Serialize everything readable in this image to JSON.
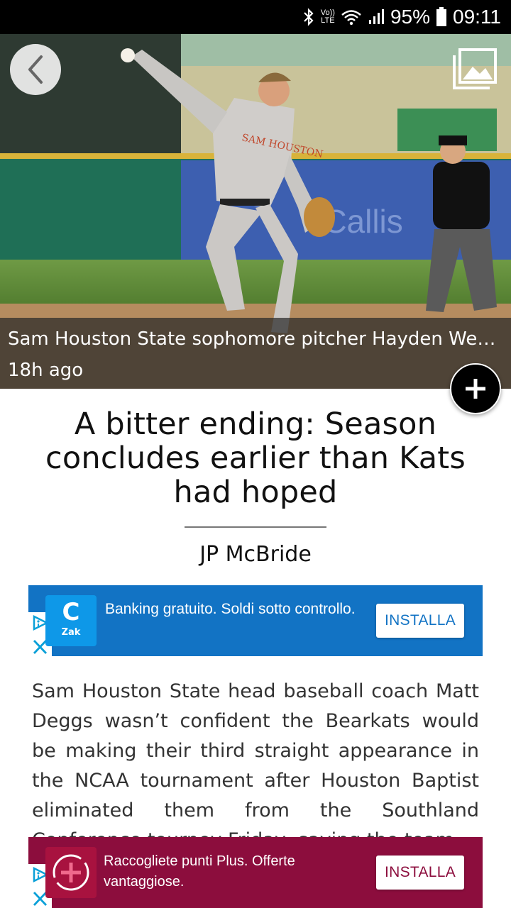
{
  "status_bar": {
    "network_top": "Vo))",
    "network_bottom": "LTE",
    "battery": "95%",
    "time": "09:11",
    "icons": [
      "bluetooth-icon",
      "wifi-icon",
      "signal-icon",
      "battery-icon"
    ]
  },
  "hero": {
    "caption": "Sam Houston State sophomore pitcher Hayden Wes…",
    "time_ago": "18h ago",
    "icons": [
      "back-arrow-icon",
      "gallery-icon",
      "plus-icon"
    ]
  },
  "article": {
    "headline": "A bitter ending: Season concludes earlier than Kats had hoped",
    "author": "JP McBride",
    "body": "Sam Houston State head baseball coach Matt Deggs wasn’t confident the Bearkats would be making their third straight appearance in the NCAA tournament after Houston Baptist eliminated them from the Southland Conference tourney Friday, saying the team"
  },
  "ads": {
    "top": {
      "logo_letter": "C",
      "logo_name": "Zak",
      "text": "Banking gratuito. Soldi sotto controllo.",
      "button": "INSTALLA",
      "color": "#1273c4"
    },
    "bottom": {
      "text": "Raccogliete punti Plus. Offerte vantaggiose.",
      "button": "INSTALLA",
      "color": "#8c0d3d"
    }
  }
}
